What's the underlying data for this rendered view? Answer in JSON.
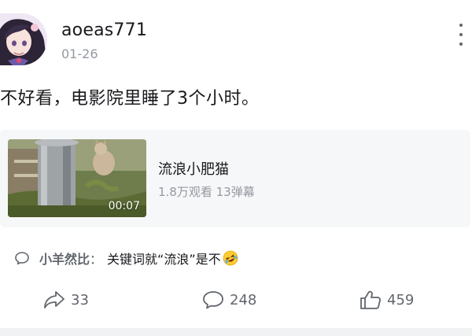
{
  "post": {
    "username": "aoeas771",
    "date": "01-26",
    "text": "不好看，电影院里睡了3个小时。"
  },
  "video": {
    "title": "流浪小肥猫",
    "views": "1.8万观看",
    "danmaku": "13弹幕",
    "duration": "00:07"
  },
  "comment": {
    "user": "小羊然比",
    "separator": "：",
    "text": "关键词就“流浪”是不",
    "emoji": "rolling-on-floor-laughing-emoji"
  },
  "actions": {
    "share_count": "33",
    "comment_count": "248",
    "like_count": "459"
  },
  "icons": {
    "more": "more-vertical-icon",
    "share": "share-arrow-icon",
    "comment": "comment-bubble-icon",
    "like": "thumbs-up-icon",
    "comment_preview": "comment-bubble-icon"
  },
  "colors": {
    "text_primary": "#18191c",
    "text_secondary": "#9499a0",
    "icon_gray": "#61666d",
    "card_bg": "#f6f7f8"
  }
}
